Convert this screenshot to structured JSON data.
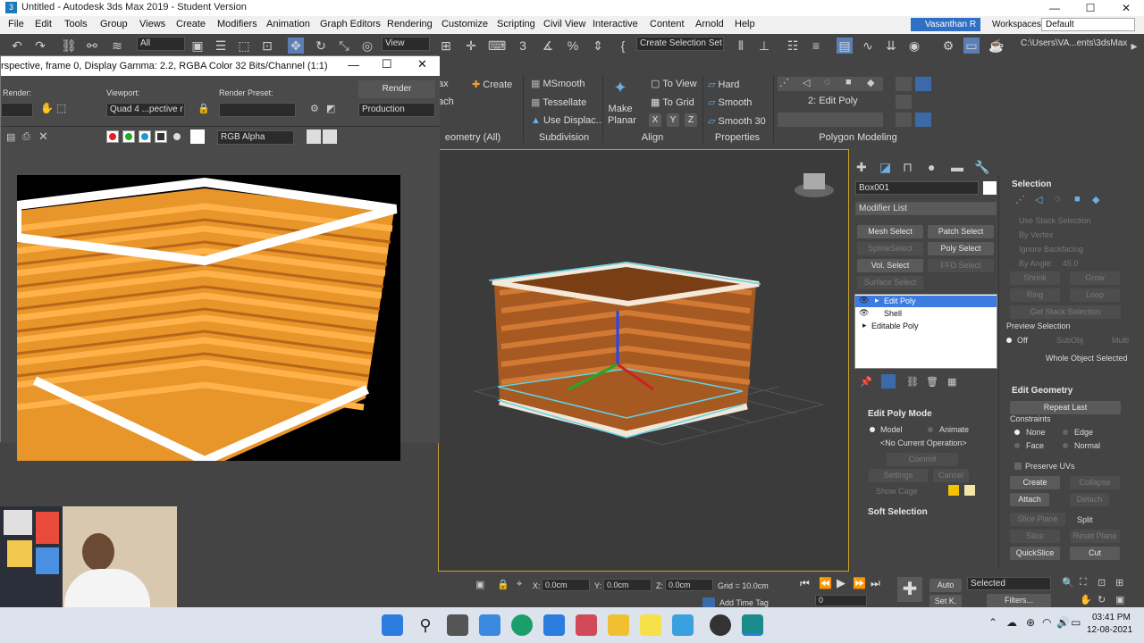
{
  "window": {
    "title": "Untitled - Autodesk 3ds Max 2019 - Student Version",
    "icon": "3",
    "min": "—",
    "max": "☐",
    "close": "✕"
  },
  "menu": [
    "File",
    "Edit",
    "Tools",
    "Group",
    "Views",
    "Create",
    "Modifiers",
    "Animation",
    "Graph Editors",
    "Rendering",
    "Customize",
    "Scripting",
    "Civil View",
    "Interactive",
    "Content",
    "Arnold",
    "Help"
  ],
  "user": "Vasanthan R",
  "workspaces_label": "Workspaces:",
  "workspace": "Default",
  "toolbar": {
    "filter": "All",
    "view": "View",
    "selection_set": "Create Selection Set",
    "path": "C:\\Users\\VA...ents\\3dsMax"
  },
  "ribbon": {
    "geometry_label": "eometry (All)",
    "ax": "ax",
    "ach": "ach",
    "create": "Create",
    "msmooth": "MSmooth",
    "tessellate": "Tessellate",
    "use_displace": "Use Displac...",
    "subdivision": "Subdivision",
    "to_view": "To View",
    "to_grid": "To Grid",
    "make": "Make",
    "planar": "Planar",
    "x": "X",
    "y": "Y",
    "z": "Z",
    "align": "Align",
    "hard": "Hard",
    "smooth": "Smooth",
    "smooth30": "Smooth 30",
    "properties": "Properties",
    "edit_poly": "2: Edit Poly",
    "polygon_modeling": "Polygon Modeling"
  },
  "render_window": {
    "title": "rspective, frame 0, Display Gamma: 2.2, RGBA Color 32 Bits/Channel (1:1)",
    "render_label": "Render:",
    "viewport_label": "Viewport:",
    "preset_label": "Render Preset:",
    "viewport_value": "Quad 4 ...pective r",
    "render_button": "Render",
    "production": "Production",
    "channel": "RGB Alpha"
  },
  "command_panel": {
    "object_name": "Box001",
    "modifier_list": "Modifier List",
    "modifier_buttons": [
      "Mesh Select",
      "Patch Select",
      "SplineSelect",
      "Poly Select",
      "Vol. Select",
      "FFD Select",
      "Surface Select"
    ],
    "stack": [
      "Edit Poly",
      "Shell",
      "Editable Poly"
    ],
    "selection": {
      "header": "Selection",
      "use_stack": "Use Stack Selection",
      "by_vertex": "By Vertex",
      "ignore_backfacing": "Ignore Backfacing",
      "by_angle": "By Angle:",
      "angle_value": "45.0",
      "shrink": "Shrink",
      "grow": "Grow",
      "ring": "Ring",
      "loop": "Loop",
      "get_stack": "Get Stack Selection",
      "preview": "Preview Selection",
      "off": "Off",
      "subobj": "SubObj",
      "multi": "Multi",
      "whole": "Whole Object Selected"
    },
    "edit_poly_mode": {
      "header": "Edit Poly Mode",
      "model": "Model",
      "animate": "Animate",
      "no_op": "<No Current Operation>",
      "commit": "Commit",
      "settings": "Settings",
      "cancel": "Cancel",
      "show_cage": "Show Cage"
    },
    "soft_selection": "Soft Selection",
    "edit_geometry": {
      "header": "Edit Geometry",
      "repeat_last": "Repeat Last",
      "constraints": "Constraints",
      "none": "None",
      "edge": "Edge",
      "face": "Face",
      "normal": "Normal",
      "preserve_uvs": "Preserve UVs",
      "create": "Create",
      "collapse": "Collapse",
      "attach": "Attach",
      "detach": "Detach",
      "slice_plane": "Slice Plane",
      "split": "Split",
      "slice": "Slice",
      "reset_plane": "Reset Plane",
      "quickslice": "QuickSlice",
      "cut": "Cut"
    }
  },
  "status": {
    "x_label": "X:",
    "x": "0.0cm",
    "y_label": "Y:",
    "y": "0.0cm",
    "z_label": "Z:",
    "z": "0.0cm",
    "grid": "Grid = 10.0cm",
    "add_time_tag": "Add Time Tag",
    "auto": "Auto",
    "selected": "Selected",
    "setk": "Set K.",
    "filters": "Filters...",
    "frame": "0"
  },
  "taskbar": {
    "time": "03:41 PM",
    "date": "12-08-2021"
  },
  "colors": {
    "accent": "#2f6fc4",
    "basket": "#e8952a",
    "selection": "#5fd3e8"
  }
}
